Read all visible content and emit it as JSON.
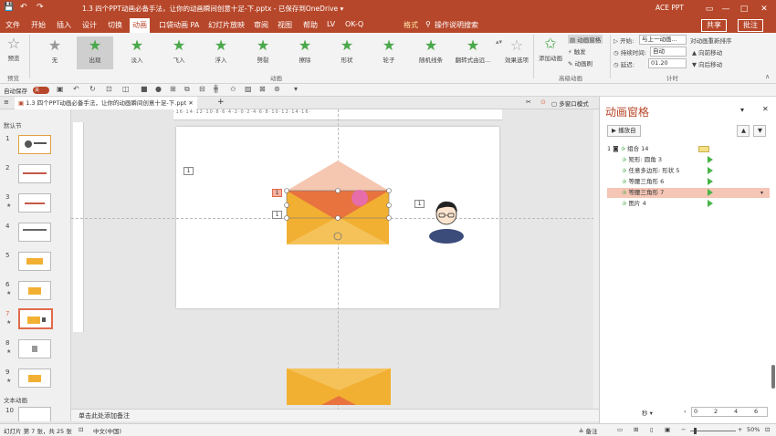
{
  "window": {
    "title": "1.3 四个PPT动画必备手法，让你的动画瞬间创意十足-下.pptx  -  已保存到OneDrive  ▾",
    "user": "ACE PPT"
  },
  "menu": {
    "items": [
      "文件",
      "开始",
      "插入",
      "设计",
      "切换",
      "动画",
      "口袋动画 PA",
      "幻灯片放映",
      "审阅",
      "视图",
      "帮助",
      "LV",
      "OK-Q",
      "格式"
    ],
    "search": "操作说明搜索",
    "share": "共享",
    "comment": "批注"
  },
  "ribbon": {
    "preview_label": "预览",
    "preview_group": "预览",
    "effects": [
      {
        "label": "无",
        "icon": "star-gray-icon"
      },
      {
        "label": "出现",
        "icon": "star-green-icon",
        "selected": true
      },
      {
        "label": "淡入",
        "icon": "star-green-icon"
      },
      {
        "label": "飞入",
        "icon": "star-green-icon"
      },
      {
        "label": "浮入",
        "icon": "star-green-icon"
      },
      {
        "label": "劈裂",
        "icon": "star-green-icon"
      },
      {
        "label": "擦除",
        "icon": "star-green-icon"
      },
      {
        "label": "形状",
        "icon": "star-green-icon"
      },
      {
        "label": "轮子",
        "icon": "star-green-icon"
      },
      {
        "label": "随机线条",
        "icon": "star-green-icon"
      },
      {
        "label": "翻转式由远...",
        "icon": "star-green-icon"
      }
    ],
    "effect_options": "效果选项",
    "animation_group": "动画",
    "add_animation": "添加动画",
    "animation_pane": "动画窗格",
    "trigger": "触发",
    "animation_painter": "动画刷",
    "advanced_group": "高级动画",
    "start_label": "开始:",
    "start_value": "与上一动画...",
    "duration_label": "持续时间:",
    "duration_value": "自动",
    "delay_label": "延迟:",
    "delay_value": "01.20",
    "reorder_label": "对动画重新排序",
    "move_earlier": "向前移动",
    "move_later": "向后移动",
    "timing_group": "计时"
  },
  "qat": {
    "autosave_label": "自动保存",
    "autosave_state": "关"
  },
  "doc_tab": {
    "name": "1.3 四个PPT动画必备手法，让你的动画瞬间创意十足-下.ppt",
    "view_mode": "多窗口模式"
  },
  "thumbs": {
    "section1": "默认节",
    "section2": "文本动画",
    "slides": [
      "1",
      "2",
      "3",
      "4",
      "5",
      "6",
      "7",
      "8",
      "9",
      "10"
    ]
  },
  "slide": {
    "tags": [
      "1",
      "1",
      "1",
      "1"
    ]
  },
  "notes": {
    "placeholder": "单击此处添加备注"
  },
  "status": {
    "slide_info": "幻灯片 第 7 张，共 25 张",
    "language": "中文(中国)",
    "notes_btn": "备注",
    "zoom": "50%"
  },
  "anim_pane": {
    "title": "动画窗格",
    "play_label": "播放自",
    "rows": [
      {
        "num": "1",
        "label": "组合 14",
        "indent": 0
      },
      {
        "num": "",
        "label": "矩形: 圆角 3",
        "indent": 1
      },
      {
        "num": "",
        "label": "任意多边形: 形状 5",
        "indent": 1
      },
      {
        "num": "",
        "label": "等腰三角形 6",
        "indent": 1
      },
      {
        "num": "",
        "label": "等腰三角形 7",
        "indent": 1,
        "selected": true
      },
      {
        "num": "",
        "label": "图片 4",
        "indent": 1
      }
    ],
    "seconds_label": "秒 ▾",
    "timeline_ticks": [
      "0",
      "2",
      "4",
      "6"
    ]
  },
  "colors": {
    "accent": "#b7472a",
    "envelope_body": "#f2b033",
    "envelope_flap": "#e8733f",
    "envelope_top_faded": "#f5c6b0"
  }
}
